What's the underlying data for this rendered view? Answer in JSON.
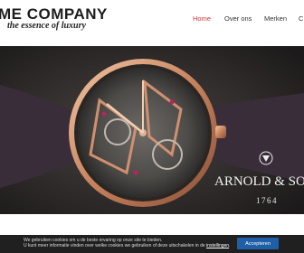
{
  "header": {
    "logo_title": "ME COMPANY",
    "logo_tagline": "the essence of luxury"
  },
  "nav": {
    "items": [
      {
        "label": "Home",
        "active": true
      },
      {
        "label": "Over ons",
        "active": false
      },
      {
        "label": "Merken",
        "active": false
      },
      {
        "label": "C",
        "active": false
      }
    ]
  },
  "hero": {
    "brand_text": "ARNOLD & SO",
    "brand_year": "1764"
  },
  "cookie_banner": {
    "line1": "We gebruiken cookies om u de beste ervaring op onze site te bieden.",
    "line2_prefix": "U kunt meer informatie vinden over welke cookies we gebruiken of deze uitschakelen in de ",
    "settings_link": "instellingen",
    "line2_suffix": ".",
    "accept_label": "Accepteren"
  },
  "colors": {
    "nav_active": "#c63a3a",
    "cookie_bg": "#202020",
    "accept_bg": "#1f5fa8"
  }
}
